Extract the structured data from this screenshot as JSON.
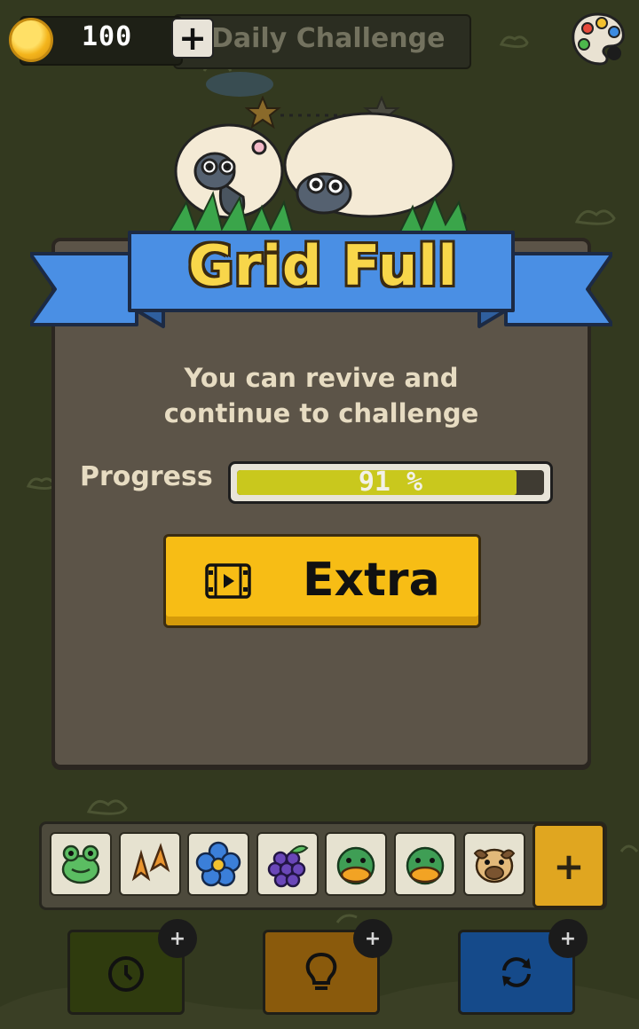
{
  "top_bar": {
    "coins": "100",
    "add_coins_label": "+",
    "daily_challenge": "Daily Challenge"
  },
  "modal": {
    "title": "Grid Full",
    "message_line1": "You can revive and",
    "message_line2": "continue to challenge",
    "progress_label": "Progress",
    "progress_value": 0.91,
    "progress_text": "91 %",
    "extra_button": "Extra"
  },
  "tray": {
    "tiles": [
      "frog-icon",
      "duck-feet-icon",
      "flower-icon",
      "grapes-icon",
      "duck-icon",
      "duck-icon",
      "dog-icon"
    ],
    "add_label": "+"
  },
  "tools": {
    "badge": "+",
    "items": [
      "clock-icon",
      "lightbulb-icon",
      "shuffle-icon"
    ]
  },
  "colors": {
    "background": "#33391f",
    "modal": "#5c5448",
    "ribbon": "#4a8fe4",
    "title": "#f8d64a",
    "button": "#f7bd15",
    "progress_fill": "#c9c81d"
  }
}
